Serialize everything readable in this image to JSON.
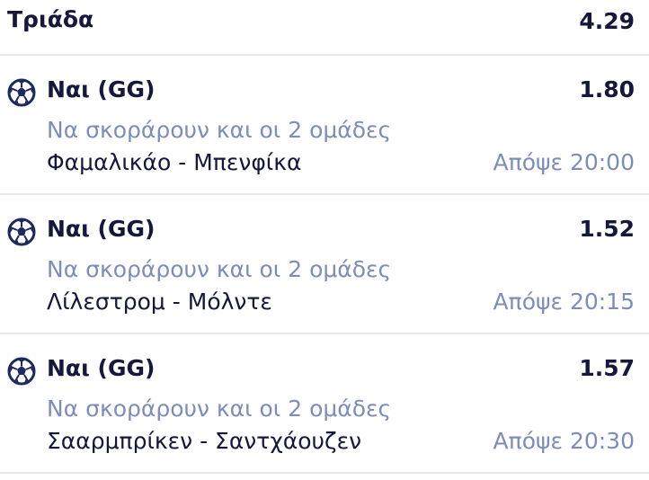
{
  "header": {
    "title": "Τριάδα",
    "total_odds": "4.29"
  },
  "bets": [
    {
      "icon": "soccer-ball-icon",
      "selection": "Ναι (GG)",
      "odds": "1.80",
      "market": "Να σκοράρουν και οι 2 ομάδες",
      "match": "Φαμαλικάο - Μπενφίκα",
      "time": "Απόψε 20:00"
    },
    {
      "icon": "soccer-ball-icon",
      "selection": "Ναι (GG)",
      "odds": "1.52",
      "market": "Να σκοράρουν και οι 2 ομάδες",
      "match": "Λίλεστρομ - Μόλντε",
      "time": "Απόψε 20:15"
    },
    {
      "icon": "soccer-ball-icon",
      "selection": "Ναι (GG)",
      "odds": "1.57",
      "market": "Να σκοράρουν και οι 2 ομάδες",
      "match": "Σααρμπρίκεν - Σαντχάουζεν",
      "time": "Απόψε 20:30"
    }
  ],
  "colors": {
    "primary_text": "#15183a",
    "secondary_text": "#7e8db5",
    "divider": "#e6e8ef",
    "ball": "#1f2a5c"
  }
}
